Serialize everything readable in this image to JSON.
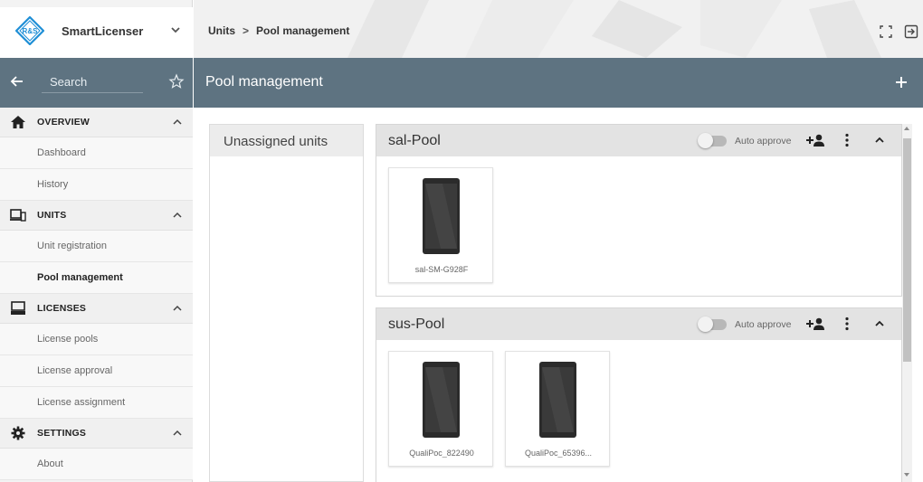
{
  "brand": {
    "name": "SmartLicenser",
    "logo_text": "R&S"
  },
  "search": {
    "label": "Search"
  },
  "breadcrumb": {
    "items": [
      "Units",
      "Pool management"
    ],
    "separator": ">"
  },
  "page": {
    "title": "Pool management"
  },
  "nav": {
    "sections": [
      {
        "label": "OVERVIEW",
        "icon": "home-icon",
        "items": [
          "Dashboard",
          "History"
        ]
      },
      {
        "label": "UNITS",
        "icon": "devices-icon",
        "items": [
          "Unit registration",
          "Pool management"
        ]
      },
      {
        "label": "LICENSES",
        "icon": "monitor-icon",
        "items": [
          "License pools",
          "License approval",
          "License assignment"
        ]
      },
      {
        "label": "SETTINGS",
        "icon": "gear-icon",
        "items": [
          "About"
        ]
      }
    ],
    "active_item": "Pool management"
  },
  "unassigned": {
    "title": "Unassigned units"
  },
  "pools": [
    {
      "name": "sal-Pool",
      "auto_approve_label": "Auto approve",
      "auto_approve": false,
      "units": [
        "sal-SM-G928F"
      ]
    },
    {
      "name": "sus-Pool",
      "auto_approve_label": "Auto approve",
      "auto_approve": false,
      "units": [
        "QualiPoc_822490",
        "QualiPoc_65396..."
      ]
    }
  ],
  "colors": {
    "accent_bar": "#5e7381",
    "sidebar_bg": "#f3f3f3",
    "pool_header": "#e3e3e3"
  }
}
